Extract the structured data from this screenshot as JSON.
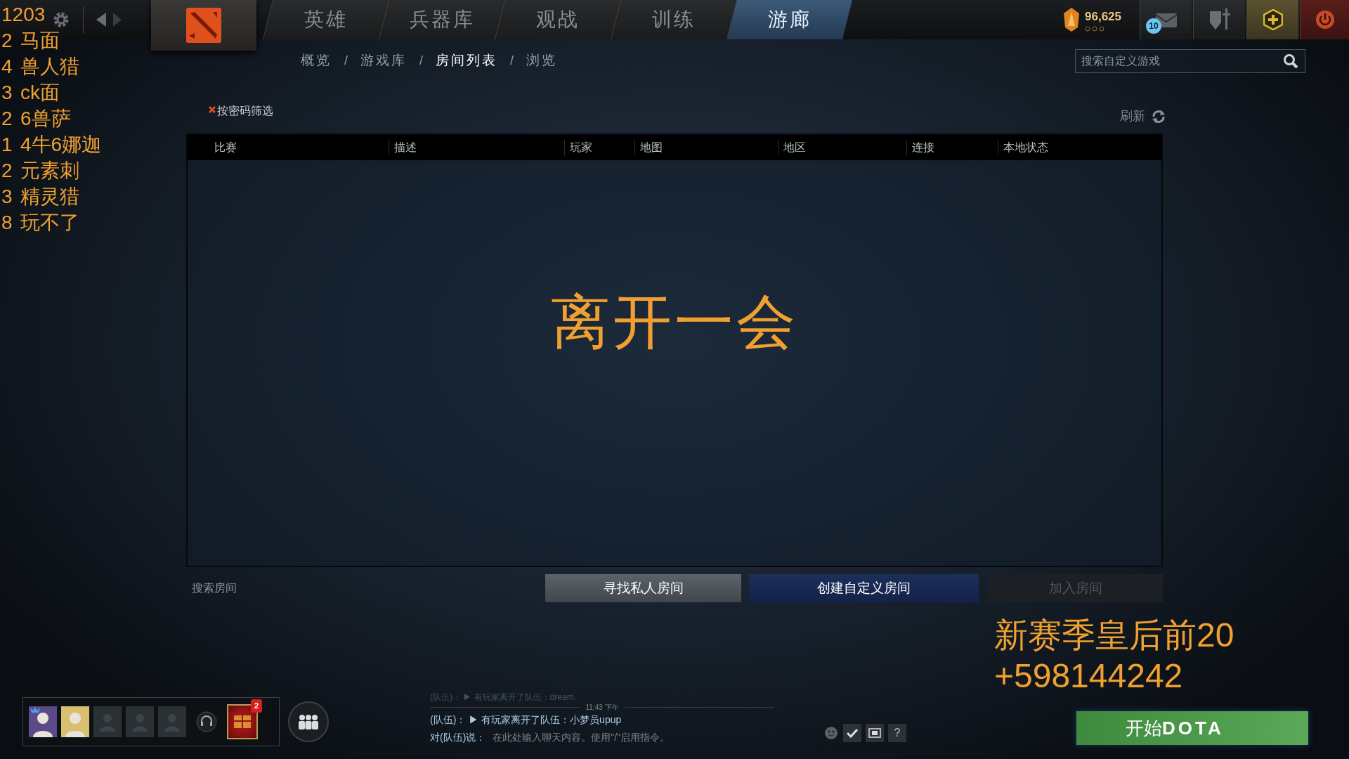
{
  "stream_overlay_left": {
    "title": "1203",
    "rows": [
      {
        "count": "2",
        "name": "马面"
      },
      {
        "count": "4",
        "name": "兽人猎"
      },
      {
        "count": "3",
        "name": "ck面"
      },
      {
        "count": "2",
        "name": "6兽萨"
      },
      {
        "count": "1",
        "name": "4牛6娜迦"
      },
      {
        "count": "2",
        "name": "元素刺"
      },
      {
        "count": "3",
        "name": "精灵猎"
      },
      {
        "count": "8",
        "name": "玩不了"
      }
    ]
  },
  "top_nav": {
    "tabs": [
      {
        "label": "英雄",
        "selected": false
      },
      {
        "label": "兵器库",
        "selected": false
      },
      {
        "label": "观战",
        "selected": false
      },
      {
        "label": "训练",
        "selected": false
      },
      {
        "label": "游廊",
        "selected": true
      }
    ],
    "currency": "96,625",
    "mail_badge": "10"
  },
  "sub_nav": {
    "items": [
      {
        "label": "概览",
        "selected": false
      },
      {
        "label": "游戏库",
        "selected": false
      },
      {
        "label": "房间列表",
        "selected": true
      },
      {
        "label": "浏览",
        "selected": false
      }
    ],
    "separator": "/"
  },
  "search": {
    "placeholder": "搜索自定义游戏"
  },
  "filter": {
    "label": "按密码筛选"
  },
  "refresh": "刷新",
  "table": {
    "columns": [
      "比赛",
      "描述",
      "玩家",
      "地图",
      "地区",
      "连接",
      "本地状态"
    ]
  },
  "away_text": "离开一会",
  "room_search": {
    "placeholder": "搜索房间"
  },
  "buttons": [
    {
      "label": "寻找私人房间",
      "kind": "secondary",
      "disabled": false
    },
    {
      "label": "创建自定义房间",
      "kind": "primary",
      "disabled": false
    },
    {
      "label": "加入房间",
      "kind": "secondary",
      "disabled": true
    }
  ],
  "stream_overlay_right": [
    "新赛季皇后前20",
    "+598144242"
  ],
  "party": {
    "slots": [
      {
        "kind": "avatar",
        "color": "#5a4a8a",
        "leader": true
      },
      {
        "kind": "avatar",
        "color": "#d8c070",
        "leader": false
      },
      {
        "kind": "empty"
      },
      {
        "kind": "empty"
      },
      {
        "kind": "empty"
      }
    ],
    "item_badge": "2"
  },
  "chat": {
    "messages": [
      {
        "kind": "message",
        "channel": "(队伍)：",
        "marker": "▶",
        "text": "有玩家离开了队伍：dream.",
        "faded": true
      },
      {
        "kind": "time",
        "text": "11:43 下午"
      },
      {
        "kind": "message",
        "channel": "(队伍)：",
        "marker": "▶",
        "text": "有玩家离开了队伍：小梦员upup",
        "faded": false
      }
    ],
    "input_label": "对(队伍)说：",
    "placeholder": "在此处输入聊天内容。使用\"/\"启用指令。",
    "help": "?"
  },
  "play_button": "开始**DOTA**"
}
